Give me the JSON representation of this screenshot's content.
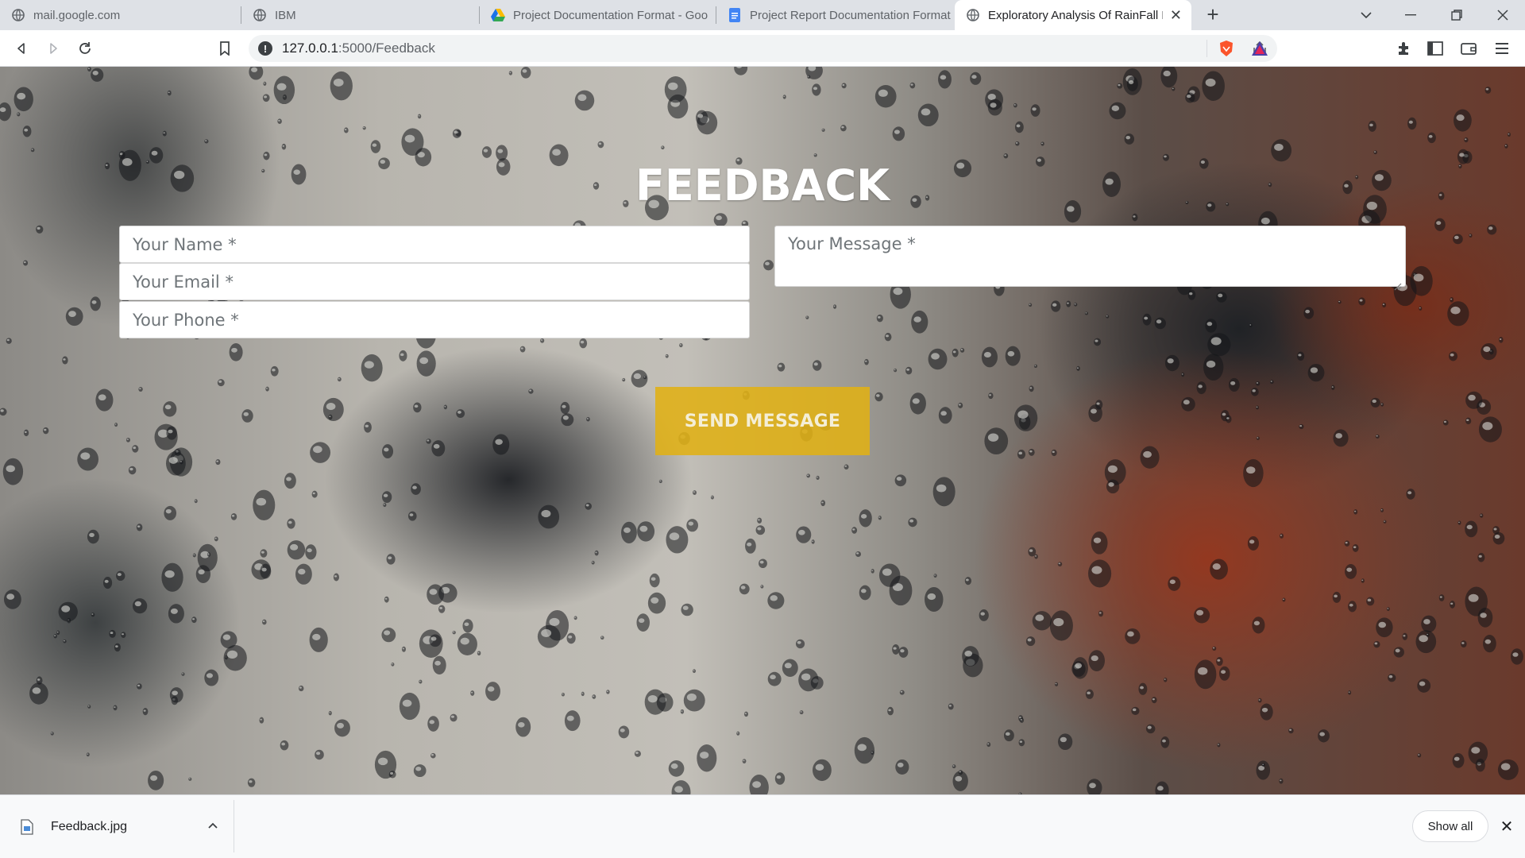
{
  "browser": {
    "tabs": [
      {
        "label": "mail.google.com",
        "icon": "globe-icon"
      },
      {
        "label": "IBM",
        "icon": "globe-icon"
      },
      {
        "label": "Project Documentation Format - Goo",
        "icon": "google-drive-icon"
      },
      {
        "label": "Project Report Documentation Format",
        "icon": "google-docs-icon"
      },
      {
        "label": "Exploratory Analysis Of RainFall F",
        "icon": "globe-icon",
        "active": true
      }
    ],
    "url_host": "127.0.0.1",
    "url_path": ":5000/Feedback"
  },
  "page": {
    "title": "FEEDBACK",
    "form": {
      "name_placeholder": "Your Name *",
      "email_placeholder": "Your Email *",
      "phone_placeholder": "Your Phone *",
      "message_placeholder": "Your Message *",
      "send_label": "SEND MESSAGE"
    }
  },
  "downloads": {
    "file_name": "Feedback.jpg",
    "show_all_label": "Show all"
  },
  "colors": {
    "send_button": "#e0b014",
    "tab_strip": "#dee1e6",
    "active_tab": "#ffffff"
  }
}
